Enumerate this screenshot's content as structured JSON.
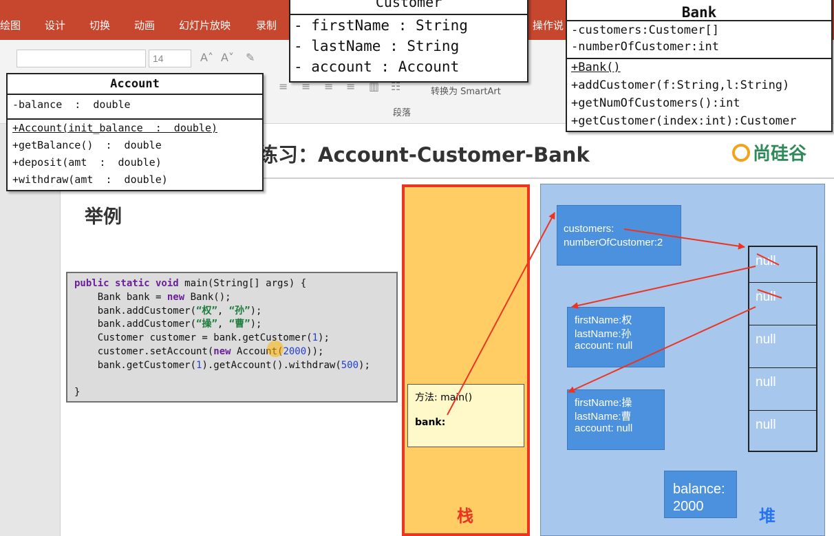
{
  "ribbon": {
    "tabs": [
      "绘图",
      "设计",
      "切换",
      "动画",
      "幻灯片放映",
      "录制",
      "操作说"
    ],
    "font_size": "14",
    "smartart": "转换为 SmartArt",
    "paragraph_group": "段落"
  },
  "slide": {
    "title": "练习：Account-Customer-Bank",
    "logo": "尚硅谷",
    "example": "举例"
  },
  "code": {
    "lines": [
      "public static void main(String[] args) {",
      "    Bank bank = new Bank();",
      "    bank.addCustomer(“权”, “孙”);",
      "    bank.addCustomer(“操”, “曹”);",
      "    Customer customer = bank.getCustomer(1);",
      "    customer.setAccount(new Account(2000));",
      "    bank.getCustomer(1).getAccount().withdraw(500);",
      "",
      "}"
    ]
  },
  "uml": {
    "account": {
      "title": "Account",
      "attributes": [
        "-balance  :  double"
      ],
      "methods": [
        "+Account(init_balance  :  double)",
        "+getBalance()  :  double",
        "+deposit(amt  :  double)",
        "+withdraw(amt  :  double)"
      ]
    },
    "customer": {
      "title": "Customer",
      "attributes": [
        "- firstName : String",
        "- lastName : String",
        "- account : Account"
      ]
    },
    "bank": {
      "title": "Bank",
      "attributes": [
        "-customers:Customer[]",
        "-numberOfCustomer:int"
      ],
      "methods": [
        "+Bank()",
        "+addCustomer(f:String,l:String)",
        "+getNumOfCustomers():int",
        "+getCustomer(index:int):Customer"
      ]
    }
  },
  "memory": {
    "stack_label": "栈",
    "heap_label": "堆",
    "frame_method": "方法: main()",
    "frame_var": "bank:",
    "bank_object": [
      "customers:",
      "numberOfCustomer:2"
    ],
    "customer_1": [
      "firstName:权",
      "lastName:孙",
      "account: null"
    ],
    "customer_2": [
      "firstName:操",
      "lastName:曹",
      "account: null"
    ],
    "array": [
      "null",
      "null",
      "null",
      "null",
      "null"
    ],
    "balance": [
      "balance:",
      "2000"
    ],
    "colors": {
      "stack": "#ffcd63",
      "stack_border": "#ed3422",
      "heap": "#a8c7ec",
      "object": "#4b91de"
    }
  }
}
